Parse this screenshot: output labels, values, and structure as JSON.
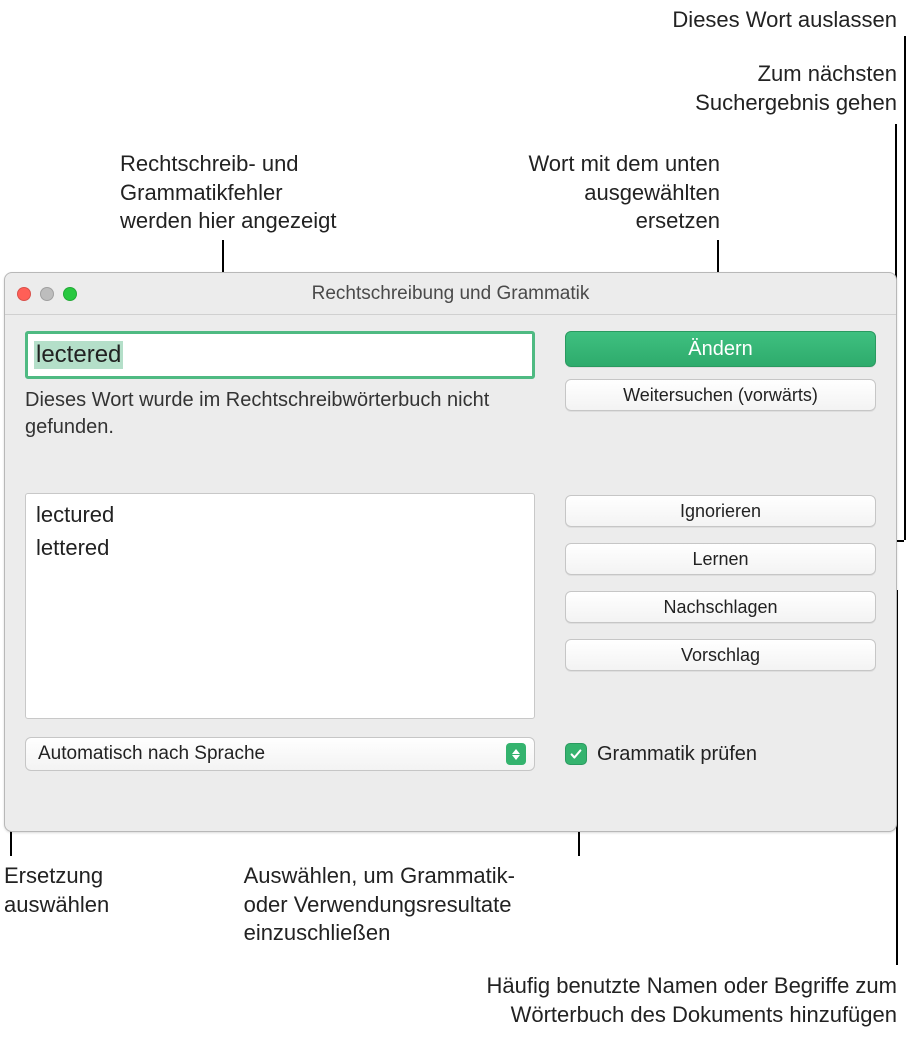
{
  "callouts": {
    "skip_word": "Dieses Wort auslassen",
    "next_result_l1": "Zum nächsten",
    "next_result_l2": "Suchergebnis gehen",
    "errors_shown_l1": "Rechtschreib- und",
    "errors_shown_l2": "Grammatikfehler",
    "errors_shown_l3": "werden hier angezeigt",
    "replace_word_l1": "Wort mit dem unten",
    "replace_word_l2": "ausgewählten",
    "replace_word_l3": "ersetzen",
    "choose_replacement_l1": "Ersetzung",
    "choose_replacement_l2": "auswählen",
    "include_grammar_l1": "Auswählen, um Grammatik-",
    "include_grammar_l2": "oder Verwendungsresultate",
    "include_grammar_l3": "einzuschließen",
    "add_to_dict_l1": "Häufig benutzte Namen oder Begriffe zum",
    "add_to_dict_l2": "Wörterbuch des Dokuments hinzufügen"
  },
  "window": {
    "title": "Rechtschreibung und Grammatik",
    "misspelled": "lectered",
    "status": "Dieses Wort wurde im Rechtschreibwörterbuch nicht gefunden.",
    "buttons": {
      "change": "Ändern",
      "find_next": "Weitersuchen (vorwärts)",
      "ignore": "Ignorieren",
      "learn": "Lernen",
      "lookup": "Nachschlagen",
      "suggest": "Vorschlag"
    },
    "suggestions": [
      "lectured",
      "lettered"
    ],
    "language_selected": "Automatisch nach Sprache",
    "check_grammar_label": "Grammatik prüfen",
    "check_grammar_checked": true
  }
}
